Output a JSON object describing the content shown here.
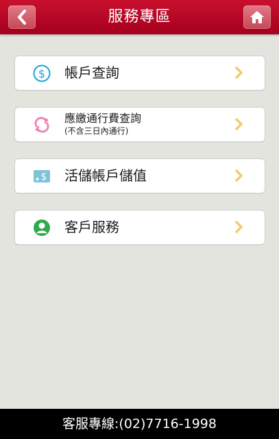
{
  "header": {
    "title": "服務專區",
    "back_icon": "chevron-left-icon",
    "home_icon": "home-icon"
  },
  "menu": {
    "items": [
      {
        "label": "帳戶查詢",
        "icon": "dollar-circle-icon",
        "icon_color": "#1aa3d6"
      },
      {
        "label": "應繳通行費查詢",
        "sublabel": "(不含三日內通行)",
        "icon": "refresh-arrows-icon",
        "icon_color": "#f07fb0"
      },
      {
        "label": "活儲帳戶儲值",
        "icon": "money-card-icon",
        "icon_color": "#7ec3d8"
      },
      {
        "label": "客戶服務",
        "icon": "user-circle-icon",
        "icon_color": "#2eaa4a"
      }
    ],
    "chevron_color": "#f0cc6a"
  },
  "footer": {
    "hotline": "客服專線:(02)7716-1998"
  },
  "colors": {
    "brand": "#b5001f",
    "background": "#e4e4df"
  }
}
